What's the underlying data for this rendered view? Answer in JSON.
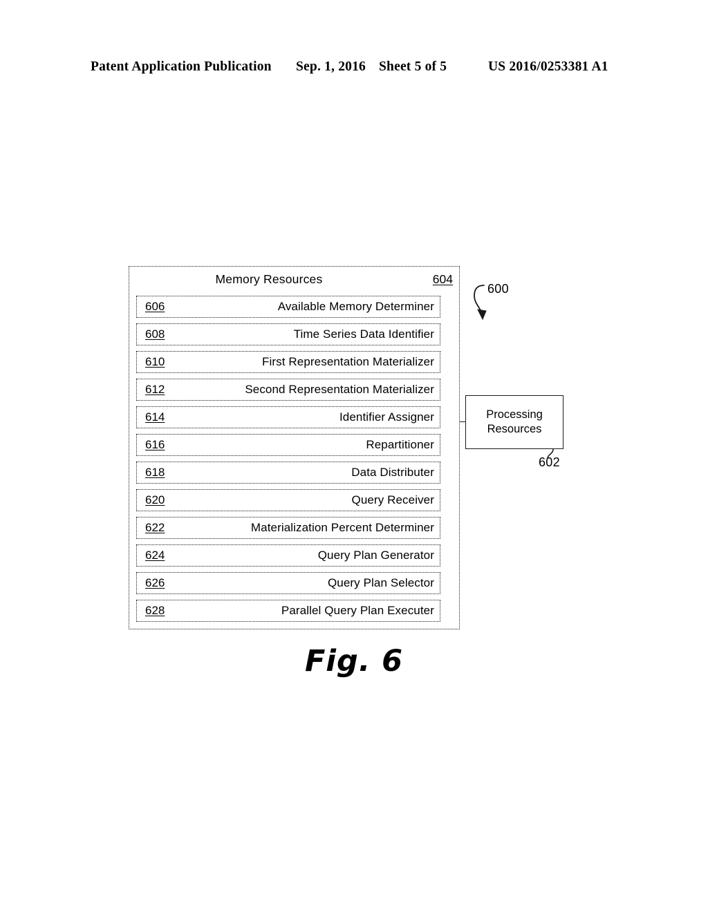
{
  "header": {
    "publication": "Patent Application Publication",
    "date": "Sep. 1, 2016",
    "sheet": "Sheet 5 of 5",
    "publication_number": "US 2016/0253381 A1"
  },
  "figure": {
    "caption": "Fig. 6",
    "system_callout": "600",
    "memory_resources": {
      "title": "Memory Resources",
      "ref": "604",
      "components": [
        {
          "ref": "606",
          "label": "Available Memory Determiner"
        },
        {
          "ref": "608",
          "label": "Time Series Data Identifier"
        },
        {
          "ref": "610",
          "label": "First Representation Materializer"
        },
        {
          "ref": "612",
          "label": "Second Representation Materializer"
        },
        {
          "ref": "614",
          "label": "Identifier Assigner"
        },
        {
          "ref": "616",
          "label": "Repartitioner"
        },
        {
          "ref": "618",
          "label": "Data Distributer"
        },
        {
          "ref": "620",
          "label": "Query Receiver"
        },
        {
          "ref": "622",
          "label": "Materialization Percent Determiner"
        },
        {
          "ref": "624",
          "label": "Query Plan Generator"
        },
        {
          "ref": "626",
          "label": "Query Plan Selector"
        },
        {
          "ref": "628",
          "label": "Parallel Query Plan Executer"
        }
      ]
    },
    "processing_resources": {
      "line1": "Processing",
      "line2": "Resources",
      "ref": "602"
    }
  },
  "colors": {
    "ink": "#1a1a1a",
    "paper": "#ffffff"
  }
}
